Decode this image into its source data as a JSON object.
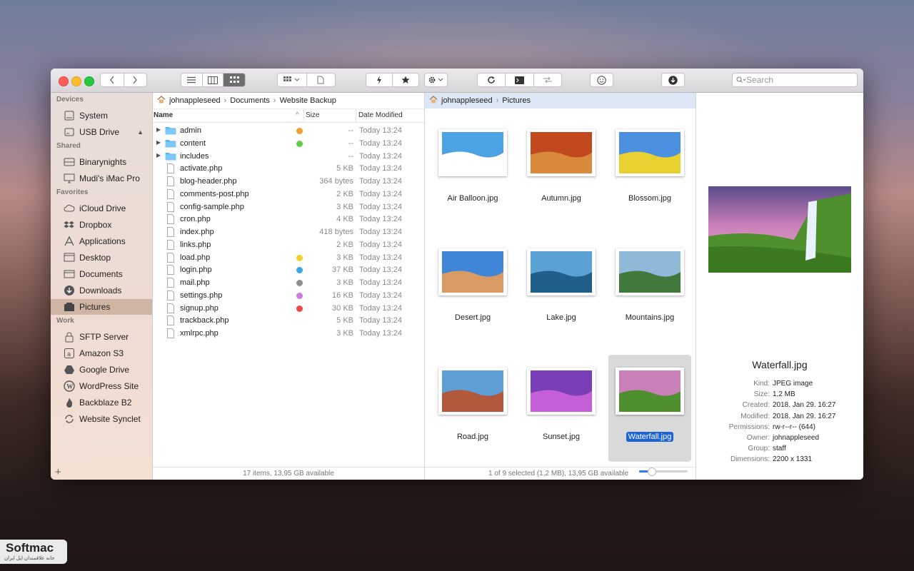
{
  "toolbar": {
    "icons": [
      "back-icon",
      "forward-icon",
      "list-view-icon",
      "column-view-icon",
      "icon-view-icon",
      "grid-menu-icon",
      "file-icon",
      "lightning-icon",
      "star-icon",
      "gear-icon",
      "refresh-icon",
      "terminal-icon",
      "sync-icon",
      "smiley-icon",
      "download-icon"
    ],
    "search_placeholder": "Search"
  },
  "sidebar": {
    "sections": [
      {
        "title": "Devices",
        "items": [
          {
            "label": "System",
            "icon": "hard-drive-icon"
          },
          {
            "label": "USB Drive",
            "icon": "usb-drive-icon",
            "eject": "▲"
          }
        ]
      },
      {
        "title": "Shared",
        "items": [
          {
            "label": "Binarynights",
            "icon": "server-icon"
          },
          {
            "label": "Mudi's iMac Pro",
            "icon": "imac-icon"
          }
        ]
      },
      {
        "title": "Favorites",
        "items": [
          {
            "label": "iCloud Drive",
            "icon": "cloud-icon"
          },
          {
            "label": "Dropbox",
            "icon": "dropbox-icon"
          },
          {
            "label": "Applications",
            "icon": "applications-icon"
          },
          {
            "label": "Desktop",
            "icon": "desktop-icon"
          },
          {
            "label": "Documents",
            "icon": "documents-icon"
          },
          {
            "label": "Downloads",
            "icon": "downloads-icon"
          },
          {
            "label": "Pictures",
            "icon": "pictures-icon",
            "selected": true
          }
        ]
      },
      {
        "title": "Work",
        "items": [
          {
            "label": "SFTP Server",
            "icon": "lock-icon"
          },
          {
            "label": "Amazon S3",
            "icon": "amazon-icon"
          },
          {
            "label": "Google Drive",
            "icon": "google-drive-icon"
          },
          {
            "label": "WordPress Site",
            "icon": "wordpress-icon"
          },
          {
            "label": "Backblaze B2",
            "icon": "flame-icon"
          },
          {
            "label": "Website Synclet",
            "icon": "sync-icon"
          }
        ]
      }
    ],
    "add_label": "+"
  },
  "pane_left": {
    "breadcrumb": [
      "johnappleseed",
      "Documents",
      "Website Backup"
    ],
    "breadcrumb_sep": "›",
    "columns": {
      "name": "Name",
      "size": "Size",
      "date": "Date Modified"
    },
    "sort_indicator": "^",
    "files": [
      {
        "name": "admin",
        "type": "folder",
        "tag": "#f0a030",
        "size": "--",
        "date": "Today 13:24"
      },
      {
        "name": "content",
        "type": "folder",
        "tag": "#5ccc46",
        "size": "--",
        "date": "Today 13:24"
      },
      {
        "name": "includes",
        "type": "folder",
        "tag": "",
        "size": "--",
        "date": "Today 13:24"
      },
      {
        "name": "activate.php",
        "type": "file",
        "tag": "",
        "size": "5 KB",
        "date": "Today 13:24"
      },
      {
        "name": "blog-header.php",
        "type": "file",
        "tag": "",
        "size": "364 bytes",
        "date": "Today 13:24"
      },
      {
        "name": "comments-post.php",
        "type": "file",
        "tag": "",
        "size": "2 KB",
        "date": "Today 13:24"
      },
      {
        "name": "config-sample.php",
        "type": "file",
        "tag": "",
        "size": "3 KB",
        "date": "Today 13:24"
      },
      {
        "name": "cron.php",
        "type": "file",
        "tag": "",
        "size": "4 KB",
        "date": "Today 13:24"
      },
      {
        "name": "index.php",
        "type": "file",
        "tag": "",
        "size": "418 bytes",
        "date": "Today 13:24"
      },
      {
        "name": "links.php",
        "type": "file",
        "tag": "",
        "size": "2 KB",
        "date": "Today 13:24"
      },
      {
        "name": "load.php",
        "type": "file",
        "tag": "#f2cf2a",
        "size": "3 KB",
        "date": "Today 13:24"
      },
      {
        "name": "login.php",
        "type": "file",
        "tag": "#3aa8e8",
        "size": "37 KB",
        "date": "Today 13:24"
      },
      {
        "name": "mail.php",
        "type": "file",
        "tag": "#8f8f8f",
        "size": "3 KB",
        "date": "Today 13:24"
      },
      {
        "name": "settings.php",
        "type": "file",
        "tag": "#c37ee0",
        "size": "16 KB",
        "date": "Today 13:24"
      },
      {
        "name": "signup.php",
        "type": "file",
        "tag": "#ea4a4a",
        "size": "30 KB",
        "date": "Today 13:24"
      },
      {
        "name": "trackback.php",
        "type": "file",
        "tag": "",
        "size": "5 KB",
        "date": "Today 13:24"
      },
      {
        "name": "xmlrpc.php",
        "type": "file",
        "tag": "",
        "size": "3 KB",
        "date": "Today 13:24"
      }
    ],
    "status": "17 items, 13,95 GB available"
  },
  "pane_middle": {
    "breadcrumb": [
      "johnappleseed",
      "Pictures"
    ],
    "images": [
      {
        "name": "Air Balloon.jpg",
        "sky": "#4ba3e3",
        "ground": "#ffffff"
      },
      {
        "name": "Autumn.jpg",
        "sky": "#c2491d",
        "ground": "#d88a3a"
      },
      {
        "name": "Blossom.jpg",
        "sky": "#4a8fe0",
        "ground": "#e8d030"
      },
      {
        "name": "Desert.jpg",
        "sky": "#3f86d8",
        "ground": "#d99a64"
      },
      {
        "name": "Lake.jpg",
        "sky": "#5aa2d6",
        "ground": "#1f5f8a"
      },
      {
        "name": "Mountains.jpg",
        "sky": "#8fb9d8",
        "ground": "#3f7a3c"
      },
      {
        "name": "Road.jpg",
        "sky": "#5f9ed4",
        "ground": "#b2583c"
      },
      {
        "name": "Sunset.jpg",
        "sky": "#7a3fb8",
        "ground": "#c45fd8"
      },
      {
        "name": "Waterfall.jpg",
        "sky": "#c97fb8",
        "ground": "#4e8f2e",
        "selected": true
      }
    ],
    "status": "1 of 9 selected (1,2 MB), 13,95 GB available",
    "zoom_level": 0.25
  },
  "preview": {
    "title": "Waterfall.jpg",
    "info": [
      {
        "key": "Kind:",
        "value": "JPEG image"
      },
      {
        "key": "Size:",
        "value": "1,2 MB"
      },
      {
        "key": "Created:",
        "value": "2018. Jan 29. 16:27"
      },
      {
        "key": "Modified:",
        "value": "2018. Jan 29. 16:27"
      },
      {
        "key": "Permissions:",
        "value": "rw-r--r-- (644)"
      },
      {
        "key": "Owner:",
        "value": "johnappleseed"
      },
      {
        "key": "Group:",
        "value": "staff"
      },
      {
        "key": "Dimensions:",
        "value": "2200 x 1331"
      }
    ]
  },
  "watermark": {
    "brand": "Softmac",
    "tagline": "خانه علاقمندان اپل ایران"
  }
}
